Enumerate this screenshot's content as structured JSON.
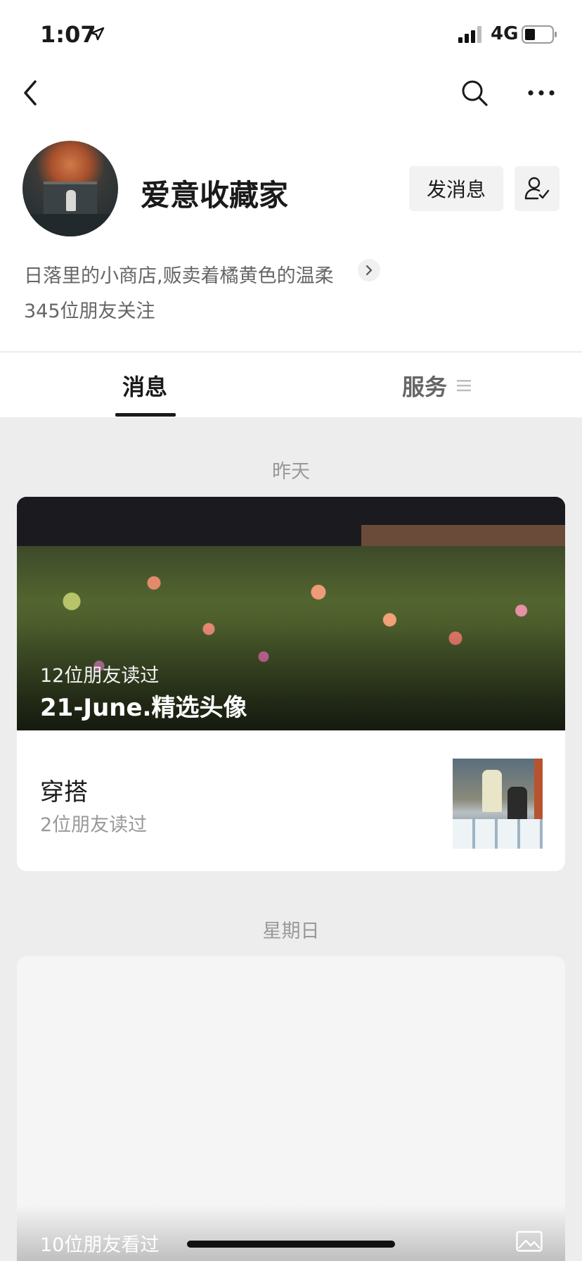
{
  "status_bar": {
    "time": "1:07",
    "network": "4G"
  },
  "profile": {
    "name": "爱意收藏家",
    "send_message_label": "发消息",
    "description": "日落里的小商店,贩卖着橘黄色的温柔",
    "followers": "345位朋友关注"
  },
  "tabs": {
    "messages": "消息",
    "services": "服务"
  },
  "feed": {
    "groups": [
      {
        "date": "昨天",
        "cover": {
          "reads": "12位朋友读过",
          "title": "21-June.精选头像"
        },
        "article": {
          "title": "穿搭",
          "reads": "2位朋友读过"
        }
      },
      {
        "date": "星期日",
        "views": "10位朋友看过"
      }
    ]
  },
  "icons": {
    "back": "chevron-left-icon",
    "search": "search-icon",
    "more": "more-dots-icon",
    "follow": "user-check-icon",
    "desc_arrow": "chevron-right-icon",
    "services_menu": "menu-icon",
    "image": "image-icon"
  },
  "colors": {
    "text_primary": "#1a1a1a",
    "text_secondary": "#666666",
    "text_muted": "#999999",
    "feed_background": "#ededed",
    "button_background": "#f2f2f2"
  }
}
